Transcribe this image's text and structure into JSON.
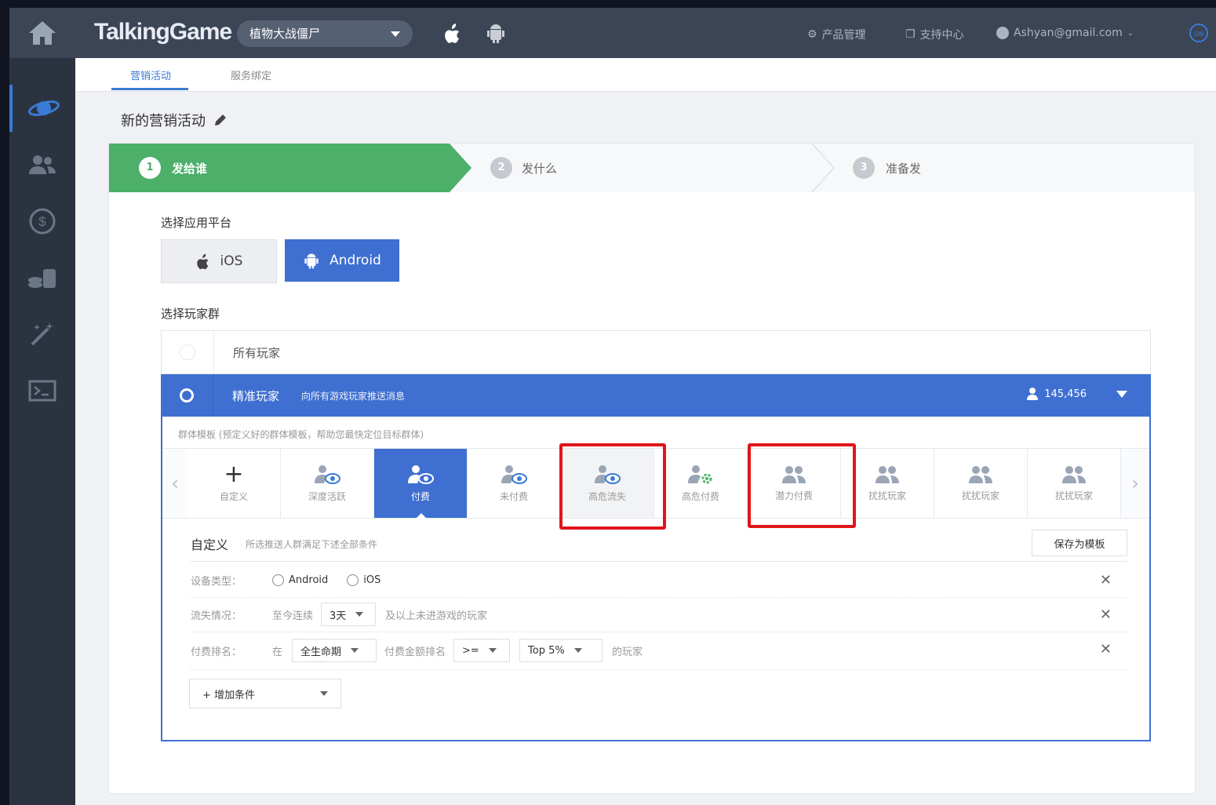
{
  "topbar": {
    "logo": "TalkingGame",
    "app_selector": "植物大战僵尸",
    "product_mgmt": "产品管理",
    "support": "支持中心",
    "account": "Ashyan@gmail.com",
    "on_badge": "ON"
  },
  "tabs": [
    "营销活动",
    "服务绑定"
  ],
  "page": {
    "title": "新的营销活动"
  },
  "steps": [
    {
      "num": "1",
      "label": "发给谁"
    },
    {
      "num": "2",
      "label": "发什么"
    },
    {
      "num": "3",
      "label": "准备发"
    }
  ],
  "platform": {
    "label": "选择应用平台",
    "ios": "iOS",
    "android": "Android",
    "selected": "Android"
  },
  "players": {
    "label": "选择玩家群",
    "all": "所有玩家",
    "precise": "精准玩家",
    "precise_desc": "向所有游戏玩家推送消息",
    "count": "145,456",
    "template_hint": "群体模板 (预定义好的群体模板，帮助您最快定位目标群体)",
    "templates": [
      "自定义",
      "深度活跃",
      "付费",
      "未付费",
      "高危流失",
      "高危付费",
      "潜力付费",
      "扰扰玩家",
      "扰扰玩家",
      "扰扰玩家"
    ],
    "active_template": "付费",
    "highlighted": [
      "高危流失",
      "潜力付费"
    ]
  },
  "custom": {
    "title": "自定义",
    "desc": "所选推送人群满足下述全部条件",
    "save_btn": "保存为模板",
    "device": {
      "label": "设备类型：",
      "opt1": "Android",
      "opt2": "iOS"
    },
    "churn": {
      "label": "流失情况：",
      "prefix": "至今连续",
      "value": "3天",
      "suffix": "及以上未进游戏的玩家"
    },
    "pay": {
      "label": "付费排名：",
      "in": "在",
      "period": "全生命期",
      "mid": "付费金额排名",
      "op": ">=",
      "rank": "Top 5%",
      "suffix": "的玩家"
    },
    "add": "+ 增加条件"
  },
  "colors": {
    "accent": "#3f6fd1",
    "step_active": "#4caf6a",
    "highlight": "#e0161b"
  }
}
